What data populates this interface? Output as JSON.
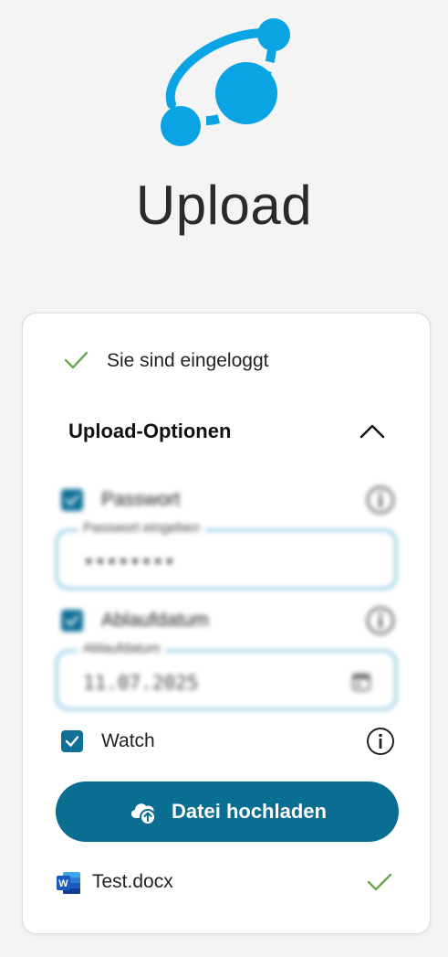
{
  "header": {
    "title": "Upload"
  },
  "status": {
    "logged_in_text": "Sie sind eingeloggt",
    "icon": "check-icon",
    "color": "#6aa84f"
  },
  "options": {
    "title": "Upload-Optionen",
    "expanded": true,
    "password": {
      "label": "Passwort",
      "checked": true,
      "field_label": "Passwort eingeben",
      "value": "••••••••"
    },
    "expiry": {
      "label": "Ablaufdatum",
      "checked": true,
      "field_label": "Ablaufdatum",
      "value": "11.07.2025"
    },
    "watch": {
      "label": "Watch",
      "checked": true
    }
  },
  "upload_button": {
    "label": "Datei hochladen",
    "icon": "cloud-upload-icon"
  },
  "file": {
    "name": "Test.docx",
    "icon": "word-icon",
    "status_icon": "check-icon"
  },
  "colors": {
    "accent": "#0a6d92",
    "logo": "#0aa3e3",
    "field_border": "#5ab0d6",
    "success": "#6aa84f"
  }
}
